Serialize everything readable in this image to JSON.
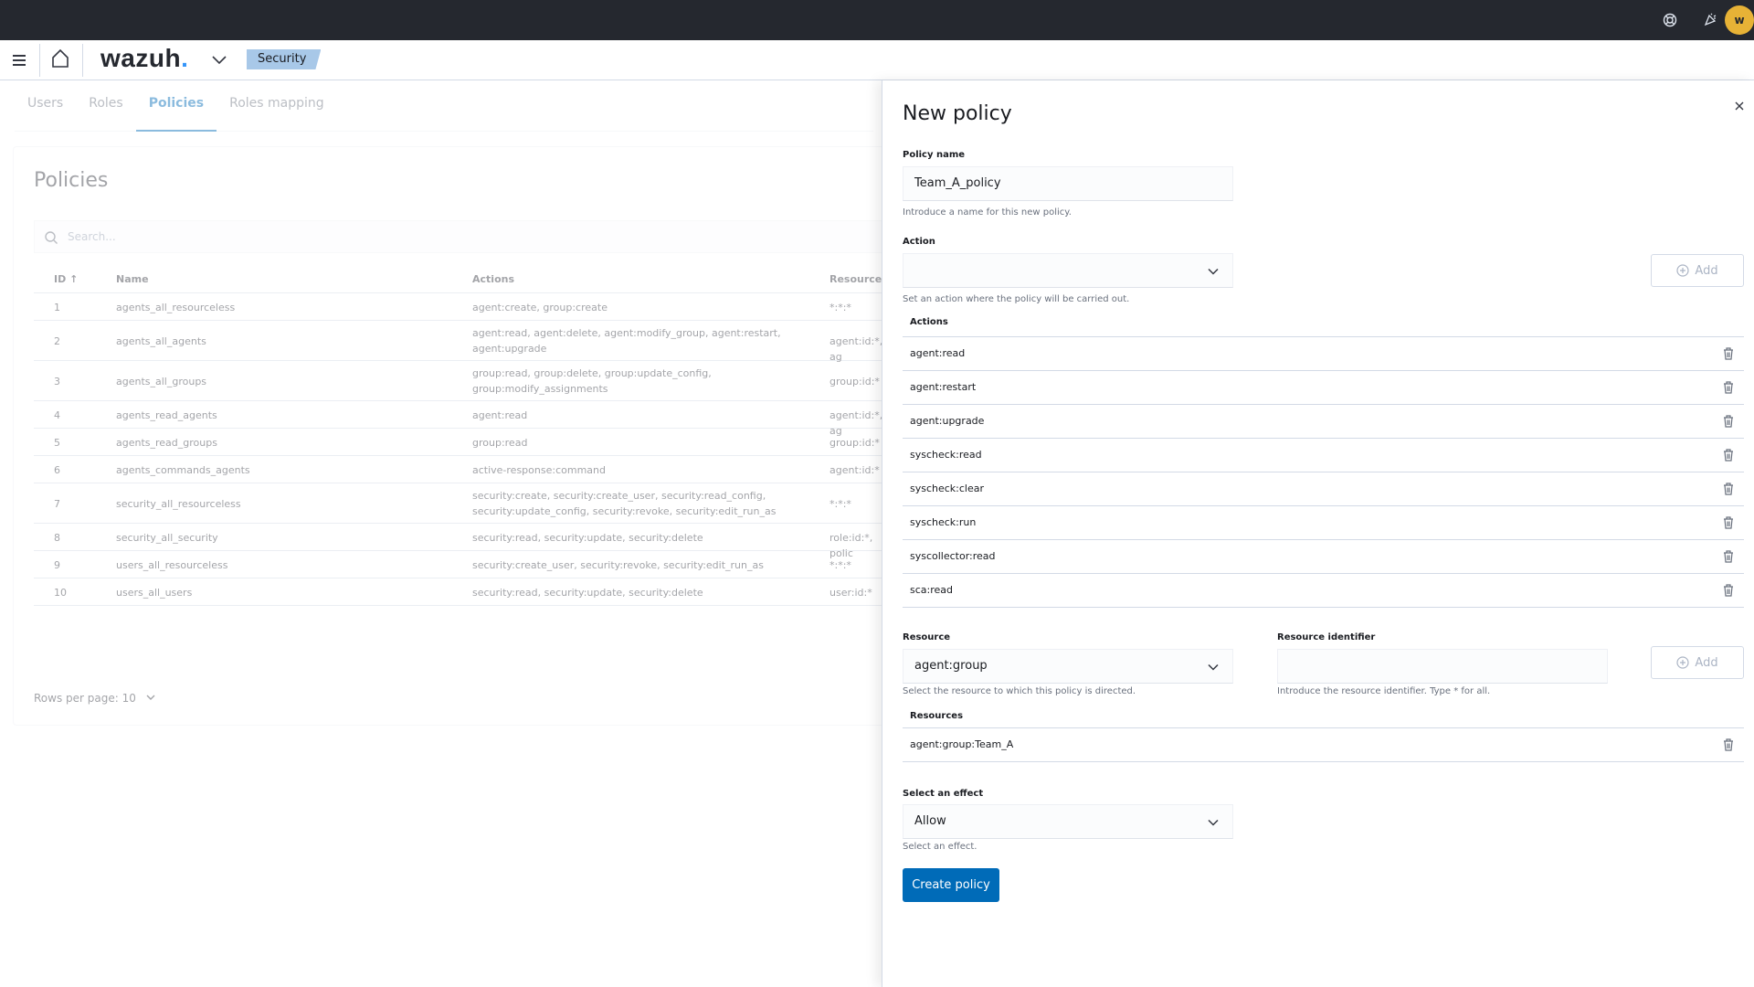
{
  "header": {
    "logo_text": "wazuh",
    "logo_dot": ".",
    "breadcrumb": "Security",
    "avatar_initial": "w"
  },
  "tabs": [
    {
      "label": "Users",
      "active": false
    },
    {
      "label": "Roles",
      "active": false
    },
    {
      "label": "Policies",
      "active": true
    },
    {
      "label": "Roles mapping",
      "active": false
    }
  ],
  "policies_panel": {
    "title": "Policies",
    "search_placeholder": "Search...",
    "columns": [
      "ID",
      "Name",
      "Actions",
      "Resources"
    ],
    "sort_indicator": "↑",
    "rows": [
      {
        "id": "1",
        "name": "agents_all_resourceless",
        "actions": [
          "agent:create, group:create"
        ],
        "resources": "*:*:*"
      },
      {
        "id": "2",
        "name": "agents_all_agents",
        "actions": [
          "agent:read, agent:delete, agent:modify_group, agent:restart,",
          "agent:upgrade"
        ],
        "resources": "agent:id:*, ag"
      },
      {
        "id": "3",
        "name": "agents_all_groups",
        "actions": [
          "group:read, group:delete, group:update_config,",
          "group:modify_assignments"
        ],
        "resources": "group:id:*"
      },
      {
        "id": "4",
        "name": "agents_read_agents",
        "actions": [
          "agent:read"
        ],
        "resources": "agent:id:*, ag"
      },
      {
        "id": "5",
        "name": "agents_read_groups",
        "actions": [
          "group:read"
        ],
        "resources": "group:id:*"
      },
      {
        "id": "6",
        "name": "agents_commands_agents",
        "actions": [
          "active-response:command"
        ],
        "resources": "agent:id:*"
      },
      {
        "id": "7",
        "name": "security_all_resourceless",
        "actions": [
          "security:create, security:create_user, security:read_config,",
          "security:update_config, security:revoke, security:edit_run_as"
        ],
        "resources": "*:*:*"
      },
      {
        "id": "8",
        "name": "security_all_security",
        "actions": [
          "security:read, security:update, security:delete"
        ],
        "resources": "role:id:*, polic"
      },
      {
        "id": "9",
        "name": "users_all_resourceless",
        "actions": [
          "security:create_user, security:revoke, security:edit_run_as"
        ],
        "resources": "*:*:*"
      },
      {
        "id": "10",
        "name": "users_all_users",
        "actions": [
          "security:read, security:update, security:delete"
        ],
        "resources": "user:id:*"
      }
    ],
    "rows_per_page": "Rows per page: 10"
  },
  "flyout": {
    "title": "New policy",
    "policy_name": {
      "label": "Policy name",
      "value": "Team_A_policy",
      "help": "Introduce a name for this new policy."
    },
    "action": {
      "label": "Action",
      "value": "",
      "help": "Set an action where the policy will be carried out.",
      "add_label": "Add"
    },
    "actions_list": {
      "title": "Actions",
      "items": [
        "agent:read",
        "agent:restart",
        "agent:upgrade",
        "syscheck:read",
        "syscheck:clear",
        "syscheck:run",
        "syscollector:read",
        "sca:read"
      ]
    },
    "resource": {
      "label": "Resource",
      "value": "agent:group",
      "help": "Select the resource to which this policy is directed."
    },
    "resource_identifier": {
      "label": "Resource identifier",
      "value": "",
      "help": "Introduce the resource identifier. Type * for all.",
      "add_label": "Add"
    },
    "resources_list": {
      "title": "Resources",
      "items": [
        "agent:group:Team_A"
      ]
    },
    "effect": {
      "label": "Select an effect",
      "value": "Allow",
      "help": "Select an effect."
    },
    "submit_label": "Create policy"
  },
  "icons": {
    "topbar": [
      "help-icon",
      "news-feed-icon"
    ],
    "header": [
      "menu-icon",
      "home-icon",
      "chevron-down-icon"
    ],
    "flyout": [
      "close-icon",
      "trash-icon",
      "plus-circle-icon"
    ]
  }
}
